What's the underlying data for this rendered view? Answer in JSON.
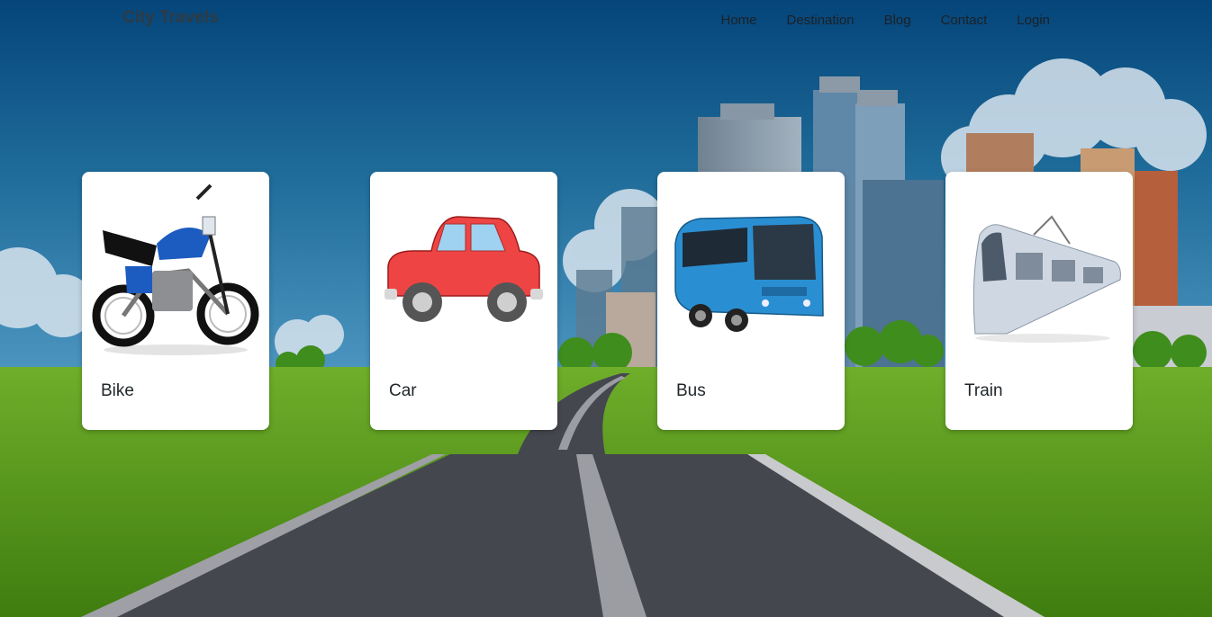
{
  "header": {
    "brand": "City Travels",
    "nav": [
      "Home",
      "Destination",
      "Blog",
      "Contact",
      "Login"
    ]
  },
  "cards": [
    {
      "label": "Bike",
      "icon": "motorcycle-icon"
    },
    {
      "label": "Car",
      "icon": "car-icon"
    },
    {
      "label": "Bus",
      "icon": "bus-icon"
    },
    {
      "label": "Train",
      "icon": "train-icon"
    }
  ],
  "colors": {
    "sky_top": "#064676",
    "sky_bottom": "#3a86b4",
    "grass": "#4f8a15",
    "road": "#45474f",
    "card_bg": "#ffffff"
  }
}
